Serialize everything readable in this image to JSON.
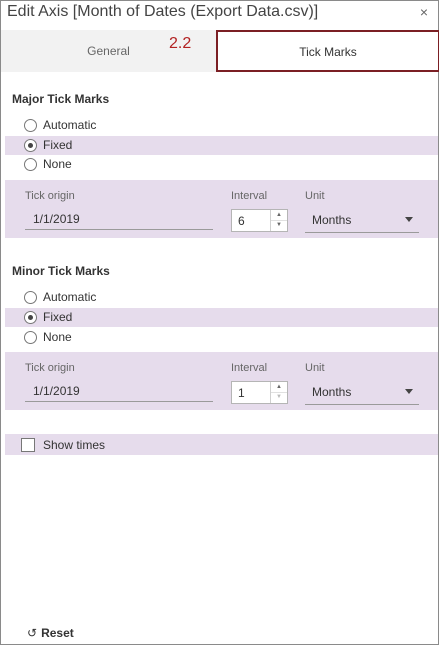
{
  "dialog": {
    "title": "Edit Axis [Month of Dates (Export Data.csv)]",
    "close_glyph": "×"
  },
  "tabs": [
    {
      "label": "General",
      "selected": false
    },
    {
      "label": "Tick Marks",
      "selected": true
    }
  ],
  "annotation": "2.2",
  "major": {
    "title": "Major Tick Marks",
    "options": [
      "Automatic",
      "Fixed",
      "None"
    ],
    "selected": "Fixed",
    "origin_label": "Tick origin",
    "origin_value": "1/1/2019",
    "interval_label": "Interval",
    "interval_value": "6",
    "unit_label": "Unit",
    "unit_value": "Months"
  },
  "minor": {
    "title": "Minor Tick Marks",
    "options": [
      "Automatic",
      "Fixed",
      "None"
    ],
    "selected": "Fixed",
    "origin_label": "Tick origin",
    "origin_value": "1/1/2019",
    "interval_label": "Interval",
    "interval_value": "1",
    "unit_label": "Unit",
    "unit_value": "Months"
  },
  "show_times": {
    "label": "Show times",
    "checked": false
  },
  "footer": {
    "reset_label": "Reset",
    "reset_glyph": "↺"
  },
  "colors": {
    "selection_bg": "#e6dcec",
    "annotation_red": "#b22222",
    "tab_outline": "#7b1f24"
  },
  "icons": {
    "close": "close-icon",
    "caret": "chevron-down-icon",
    "spin_up": "arrow-up-icon",
    "spin_down": "arrow-down-icon",
    "reset": "reset-icon"
  }
}
